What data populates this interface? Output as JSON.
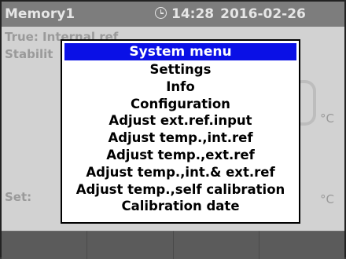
{
  "header": {
    "title": "Memory1",
    "time": "14:28",
    "date": "2016-02-26"
  },
  "background": {
    "true_label": "True: Internal ref",
    "stability_label": "Stabilit",
    "set_label": "Set:",
    "unit_upper": "°C",
    "unit_lower": "°C",
    "lower_mark": ","
  },
  "menu": {
    "title": "System menu",
    "items": [
      "Settings",
      "Info",
      "Configuration",
      "Adjust ext.ref.input",
      "Adjust temp.,int.ref",
      "Adjust temp.,ext.ref",
      "Adjust temp.,int.& ext.ref",
      "Adjust temp.,self calibration",
      "Calibration date"
    ]
  },
  "colors": {
    "header_bg": "#7d7d7d",
    "menu_title_bg": "#0a10e6",
    "screen_bg": "#d2d2d2"
  },
  "icons": {
    "clock": "clock-icon"
  }
}
